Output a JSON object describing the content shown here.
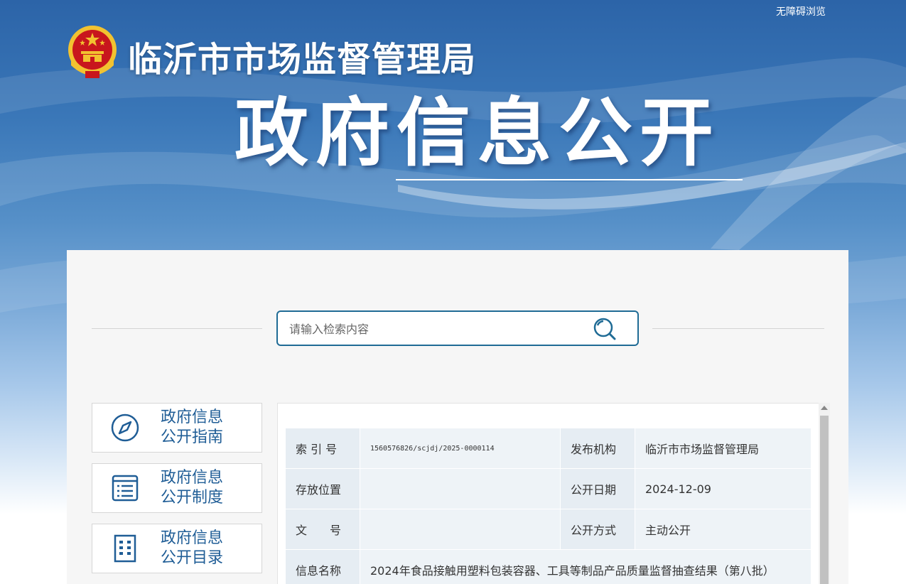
{
  "header": {
    "accessibility_link": "无障碍浏览",
    "org_name": "临沂市市场监督管理局",
    "hero_title": "政府信息公开",
    "emblem_icon": "national-emblem-icon"
  },
  "search": {
    "placeholder": "请输入检索内容",
    "icon": "search-icon"
  },
  "sidebar": {
    "items": [
      {
        "label_line1": "政府信息",
        "label_line2": "公开指南",
        "icon": "compass-icon"
      },
      {
        "label_line1": "政府信息",
        "label_line2": "公开制度",
        "icon": "document-list-icon"
      },
      {
        "label_line1": "政府信息",
        "label_line2": "公开目录",
        "icon": "catalog-icon"
      }
    ]
  },
  "meta": {
    "index_no_label": "索 引 号",
    "index_no_value": "1560576826/scjdj/2025-0000114",
    "publisher_label": "发布机构",
    "publisher_value": "临沂市市场监督管理局",
    "storage_label": "存放位置",
    "storage_value": "",
    "pub_date_label": "公开日期",
    "pub_date_value": "2024-12-09",
    "doc_no_label": "文　　号",
    "doc_no_value": "",
    "pub_method_label": "公开方式",
    "pub_method_value": "主动公开",
    "info_name_label": "信息名称",
    "info_name_value": "2024年食品接触用塑料包装容器、工具等制品产品质量监督抽查结果（第八批）"
  },
  "colors": {
    "brand_blue": "#2c64a8",
    "accent_teal": "#1f6b95",
    "sidebar_text": "#1f5d96",
    "emblem_red": "#c8161d",
    "emblem_gold": "#f2c230"
  }
}
